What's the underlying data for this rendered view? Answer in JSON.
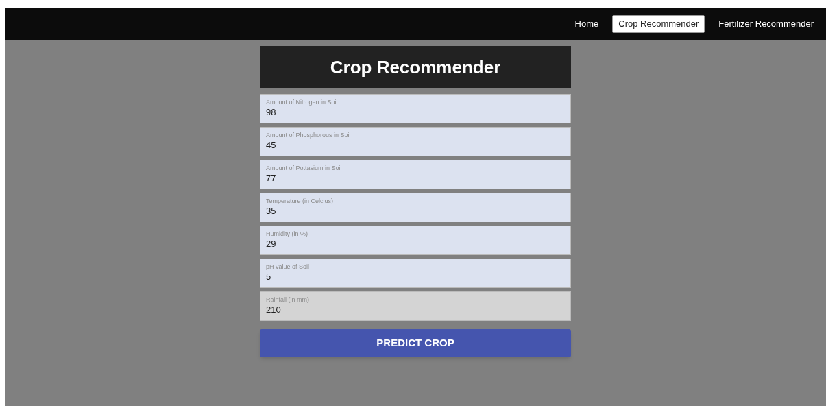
{
  "nav": {
    "items": [
      {
        "label": "Home",
        "selected": false
      },
      {
        "label": "Crop Recommender",
        "selected": true
      },
      {
        "label": "Fertilizer Recommender",
        "selected": false
      }
    ]
  },
  "form": {
    "title": "Crop Recommender",
    "fields": [
      {
        "label": "Amount of Nitrogen in Soil",
        "value": "98",
        "focused": false
      },
      {
        "label": "Amount of Phosphorous in Soil",
        "value": "45",
        "focused": false
      },
      {
        "label": "Amount of Pottasium in Soil",
        "value": "77",
        "focused": false
      },
      {
        "label": "Temperature (in Celcius)",
        "value": "35",
        "focused": false
      },
      {
        "label": "Humidity (in %)",
        "value": "29",
        "focused": false
      },
      {
        "label": "pH value of Soil",
        "value": "5",
        "focused": false
      },
      {
        "label": "Rainfall (in mm)",
        "value": "210",
        "focused": true
      }
    ],
    "submit": "PREDICT CROP"
  }
}
